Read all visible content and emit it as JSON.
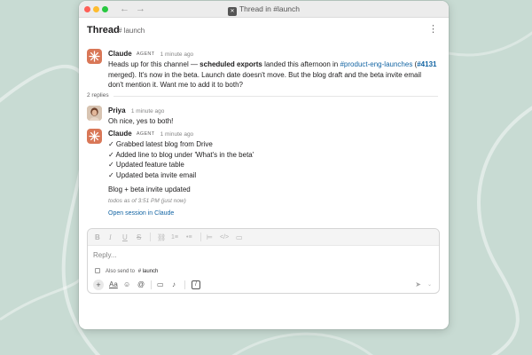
{
  "window": {
    "title": "Thread in #launch"
  },
  "thread": {
    "title": "Thread",
    "channel": "# launch"
  },
  "colors": {
    "background": "#c8dbd3",
    "accent_link": "#1264a3",
    "claude_avatar": "#d97757"
  },
  "messages": [
    {
      "author": "Claude",
      "badge": "AGENT",
      "time": "1 minute ago",
      "avatar_icon": "claude-spark-icon",
      "parts": {
        "t1": "Heads up for this channel — ",
        "b1": "scheduled exports",
        "t2": " landed this afternoon in ",
        "channel_link": "#product-eng-launches",
        "t3": " (",
        "pr_link": "#4131",
        "t4": " merged). It's now in the beta. Launch date doesn't move. But the blog draft and the beta invite email don't mention it. Want me to add it to both?"
      }
    },
    {
      "author": "Priya",
      "time": "1 minute ago",
      "avatar_icon": "priya-avatar",
      "text": "Oh nice, yes to both!"
    },
    {
      "author": "Claude",
      "badge": "AGENT",
      "time": "1 minute ago",
      "avatar_icon": "claude-spark-icon",
      "checklist": [
        "✓ Grabbed latest blog from Drive",
        "✓ Added line to blog under 'What's in the beta'",
        "✓ Updated feature table",
        "✓ Updated beta invite email"
      ],
      "summary": "Blog + beta invite updated",
      "footnote": "todos as of 3:51 PM (just now)",
      "session_link": "Open session in Claude"
    }
  ],
  "replies": {
    "count_label": "2 replies"
  },
  "composer": {
    "placeholder": "Reply...",
    "also_send_label": "Also send to",
    "also_send_channel": "# launch",
    "format_icons": [
      "bold-icon",
      "italic-icon",
      "underline-icon",
      "strikethrough-icon",
      "link-icon",
      "ordered-list-icon",
      "bulleted-list-icon",
      "blockquote-icon",
      "code-icon",
      "code-block-icon"
    ],
    "tool_icons": [
      "plus-icon",
      "text-format-icon",
      "emoji-icon",
      "mention-icon",
      "video-icon",
      "microphone-icon",
      "slash-command-icon"
    ],
    "format_toggle_label": "Aa"
  }
}
